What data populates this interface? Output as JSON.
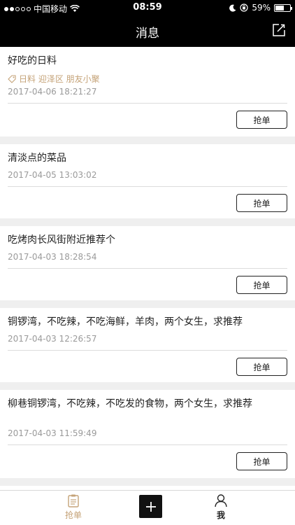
{
  "status_bar": {
    "carrier": "中国移动",
    "time": "08:59",
    "battery": "59%",
    "battery_level": 0.59
  },
  "nav": {
    "title": "消息"
  },
  "requests": [
    {
      "title": "好吃的日料",
      "tags": "日料 迎泽区 朋友小聚",
      "date": "2017-04-06 18:21:27",
      "button": "抢单"
    },
    {
      "title": "清淡点的菜品",
      "date": "2017-04-05 13:03:02",
      "button": "抢单"
    },
    {
      "title": "吃烤肉长风街附近推荐个",
      "date": "2017-04-03 18:28:54",
      "button": "抢单"
    },
    {
      "title": "铜锣湾，不吃辣，不吃海鲜，羊肉，两个女生，求推荐",
      "date": "2017-04-03 12:26:57",
      "button": "抢单"
    },
    {
      "title": "柳巷铜锣湾，不吃辣，不吃发的食物，两个女生，求推荐",
      "date": "2017-04-03 11:59:49",
      "button": "抢单"
    }
  ],
  "tab_bar": {
    "orders_label": "抢单",
    "me_label": "我"
  },
  "colors": {
    "accent": "#c5a378",
    "header": "#000000"
  }
}
